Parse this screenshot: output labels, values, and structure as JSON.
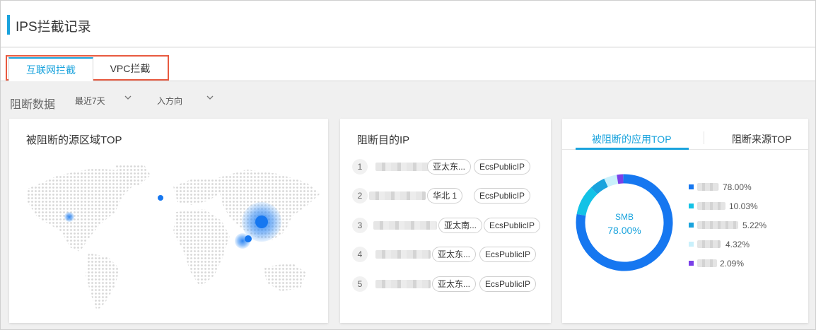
{
  "header": {
    "title": "IPS拦截记录"
  },
  "tabs": [
    {
      "label": "互联网拦截",
      "active": true
    },
    {
      "label": "VPC拦截",
      "active": false
    }
  ],
  "filters": {
    "label": "阻断数据",
    "time_range": "最近7天",
    "direction": "入方向"
  },
  "map_card": {
    "title": "被阻断的源区域TOP"
  },
  "ip_card": {
    "title": "阻断目的IP",
    "rows": [
      {
        "index": "1",
        "region": "亚太东...",
        "type": "EcsPublicIP"
      },
      {
        "index": "2",
        "region": "华北 1",
        "type": "EcsPublicIP"
      },
      {
        "index": "3",
        "region": "亚太南...",
        "type": "EcsPublicIP"
      },
      {
        "index": "4",
        "region": "亚太东...",
        "type": "EcsPublicIP"
      },
      {
        "index": "5",
        "region": "亚太东...",
        "type": "EcsPublicIP"
      }
    ]
  },
  "app_card": {
    "tabs": [
      {
        "label": "被阻断的应用TOP",
        "active": true
      },
      {
        "label": "阻断来源TOP",
        "active": false
      }
    ],
    "donut_center": {
      "name": "SMB",
      "value": "78.00%"
    },
    "legend": [
      {
        "pct": "78.00%",
        "value": 78.0,
        "color": "#1677f0"
      },
      {
        "pct": "10.03%",
        "value": 10.03,
        "color": "#13c2e6"
      },
      {
        "pct": "5.22%",
        "value": 5.22,
        "color": "#1aa3dd"
      },
      {
        "pct": "4.32%",
        "value": 4.32,
        "color": "#c9f0fb"
      },
      {
        "pct": "2.09%",
        "value": 2.09,
        "color": "#7a40e8"
      }
    ]
  }
}
